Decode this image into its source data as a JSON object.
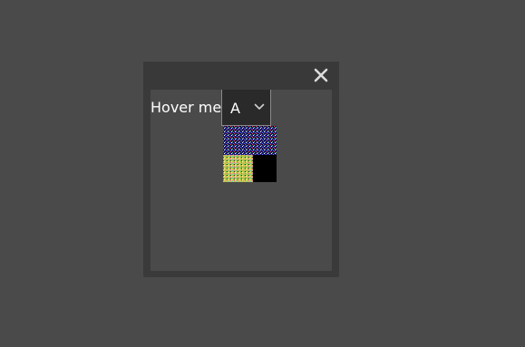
{
  "window": {
    "close_icon": "close-icon"
  },
  "content": {
    "hover_label": "Hover me",
    "select": {
      "value": "A",
      "chevron_icon": "chevron-down-icon"
    }
  },
  "colors": {
    "background": "#4a4a4a",
    "window_frame": "#3a3a3a",
    "select_bg": "#2a2a2a",
    "text": "#ffffff"
  }
}
